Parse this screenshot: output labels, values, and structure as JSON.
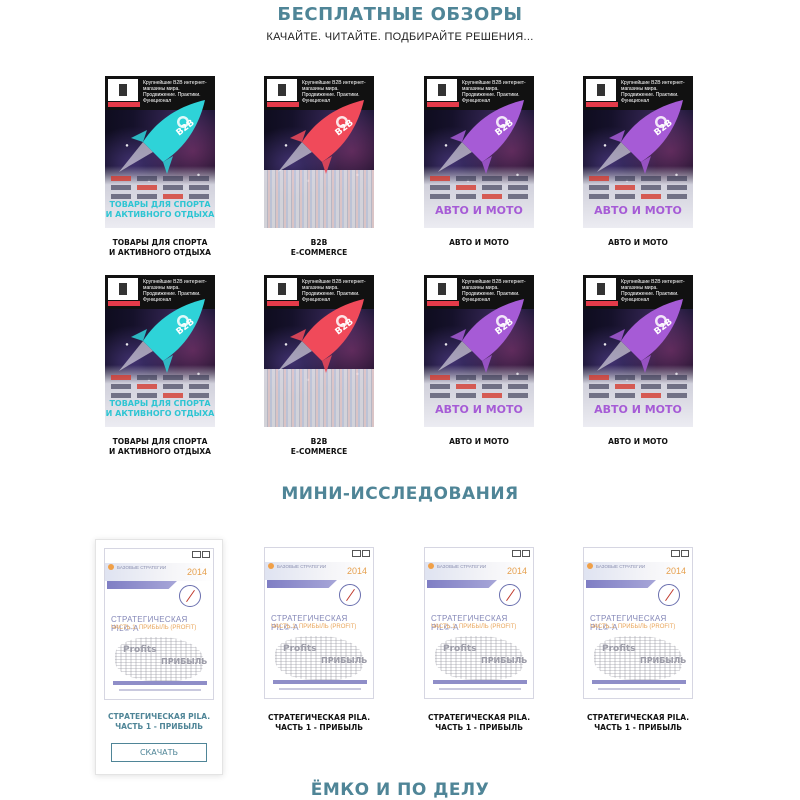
{
  "free_reviews": {
    "title": "БЕСПЛАТНЫЕ ОБЗОРЫ",
    "subtitle": "КАЧАЙТЕ. ЧИТАЙТЕ. ПОДБИРАЙТЕ РЕШЕНИЯ...",
    "cover_header_text": "Крупнейшие B2B интернет-магазины мира. Продвижение. Практики. Функционал",
    "items": [
      {
        "caption": "ТОВАРЫ ДЛЯ СПОРТА\nИ АКТИВНОГО ОТДЫХА",
        "cover_label": "ТОВАРЫ ДЛЯ СПОРТА\nИ АКТИВНОГО ОТДЫХА",
        "rocket_color": "#2ed3d8",
        "label_color": "#2ec5d3",
        "variant": "sport"
      },
      {
        "caption": "B2B\nE-COMMERCE",
        "cover_label": "",
        "rocket_color": "#f04a5a",
        "label_color": "#f04a5a",
        "variant": "b2b"
      },
      {
        "caption": "АВТО И МОТО",
        "cover_label": "АВТО И МОТО",
        "rocket_color": "#a65bd6",
        "label_color": "#a65bd6",
        "variant": "auto"
      },
      {
        "caption": "АВТО И МОТО",
        "cover_label": "АВТО И МОТО",
        "rocket_color": "#a65bd6",
        "label_color": "#a65bd6",
        "variant": "auto"
      },
      {
        "caption": "ТОВАРЫ ДЛЯ СПОРТА\nИ АКТИВНОГО ОТДЫХА",
        "cover_label": "ТОВАРЫ ДЛЯ СПОРТА\nИ АКТИВНОГО ОТДЫХА",
        "rocket_color": "#2ed3d8",
        "label_color": "#2ec5d3",
        "variant": "sport"
      },
      {
        "caption": "B2B\nE-COMMERCE",
        "cover_label": "",
        "rocket_color": "#f04a5a",
        "label_color": "#f04a5a",
        "variant": "b2b"
      },
      {
        "caption": "АВТО И МОТО",
        "cover_label": "АВТО И МОТО",
        "rocket_color": "#a65bd6",
        "label_color": "#a65bd6",
        "variant": "auto"
      },
      {
        "caption": "АВТО И МОТО",
        "cover_label": "АВТО И МОТО",
        "rocket_color": "#a65bd6",
        "label_color": "#a65bd6",
        "variant": "auto"
      }
    ]
  },
  "mini_research": {
    "title": "МИНИ-ИССЛЕДОВАНИЯ",
    "doc": {
      "label": "БАЗОВЫЕ СТРАТЕГИИ",
      "year": "2014",
      "title": "СТРАТЕГИЧЕСКАЯ PIL©-A",
      "part": "ЧАСТЬ 1. ПРИБЫЛЬ (PROFIT)",
      "cloud_words": [
        "Profits",
        "ПРИБЫЛЬ"
      ]
    },
    "items": [
      {
        "caption": "СТРАТЕГИЧЕСКАЯ PILA.\nЧАСТЬ 1 - ПРИБЫЛЬ",
        "active": true,
        "caption_color": "#4f8597"
      },
      {
        "caption": "СТРАТЕГИЧЕСКАЯ PILA.\nЧАСТЬ 1 - ПРИБЫЛЬ",
        "active": false,
        "caption_color": "#111111"
      },
      {
        "caption": "СТРАТЕГИЧЕСКАЯ PILA.\nЧАСТЬ 1 - ПРИБЫЛЬ",
        "active": false,
        "caption_color": "#111111"
      },
      {
        "caption": "СТРАТЕГИЧЕСКАЯ PILA.\nЧАСТЬ 1 - ПРИБЫЛЬ",
        "active": false,
        "caption_color": "#111111"
      }
    ],
    "download_label": "СКАЧАТЬ"
  },
  "next_section": {
    "title": "ЁМКО И ПО ДЕЛУ"
  },
  "colors": {
    "accent": "#4f8597"
  }
}
